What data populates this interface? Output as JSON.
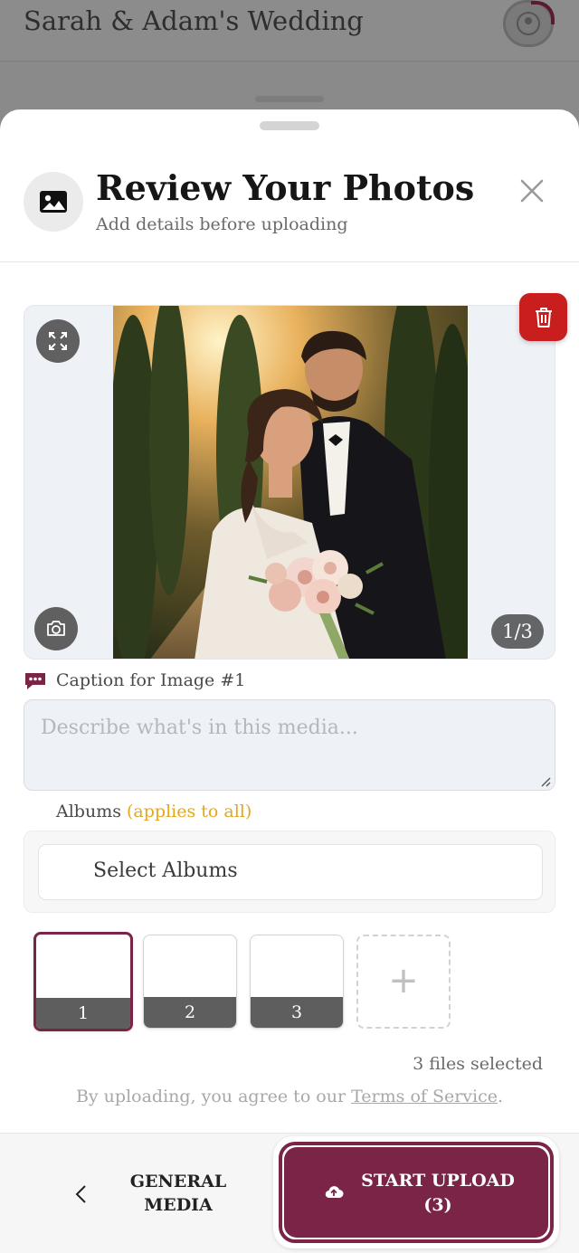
{
  "background": {
    "app_title": "Sarah & Adam's Wedding"
  },
  "modal": {
    "title": "Review Your Photos",
    "subtitle": "Add details before uploading",
    "photo_counter": "1/3",
    "caption": {
      "label": "Caption for Image #1",
      "placeholder": "Describe what's in this media...",
      "value": ""
    },
    "albums": {
      "label": "Albums",
      "note": "(applies to all)",
      "select_placeholder": "Select Albums"
    },
    "thumbnails": [
      {
        "number": "1",
        "selected": true
      },
      {
        "number": "2",
        "selected": false
      },
      {
        "number": "3",
        "selected": false
      }
    ],
    "add_more_symbol": "+",
    "files_selected": "3 files selected",
    "terms": {
      "prefix": "By uploading, you agree to our ",
      "link": "Terms of Service",
      "suffix": "."
    }
  },
  "footer": {
    "back_label": "GENERAL MEDIA",
    "upload_label": "START UPLOAD",
    "upload_count": "(3)"
  },
  "colors": {
    "accent": "#7a2448",
    "delete": "#c81e1e",
    "albums_note": "#e6a61a"
  },
  "icons": [
    "image-icon",
    "close-icon",
    "expand-icon",
    "camera-icon",
    "trash-icon",
    "comment-icon",
    "plus-icon",
    "chevron-left-icon",
    "cloud-upload-icon",
    "user-icon"
  ]
}
